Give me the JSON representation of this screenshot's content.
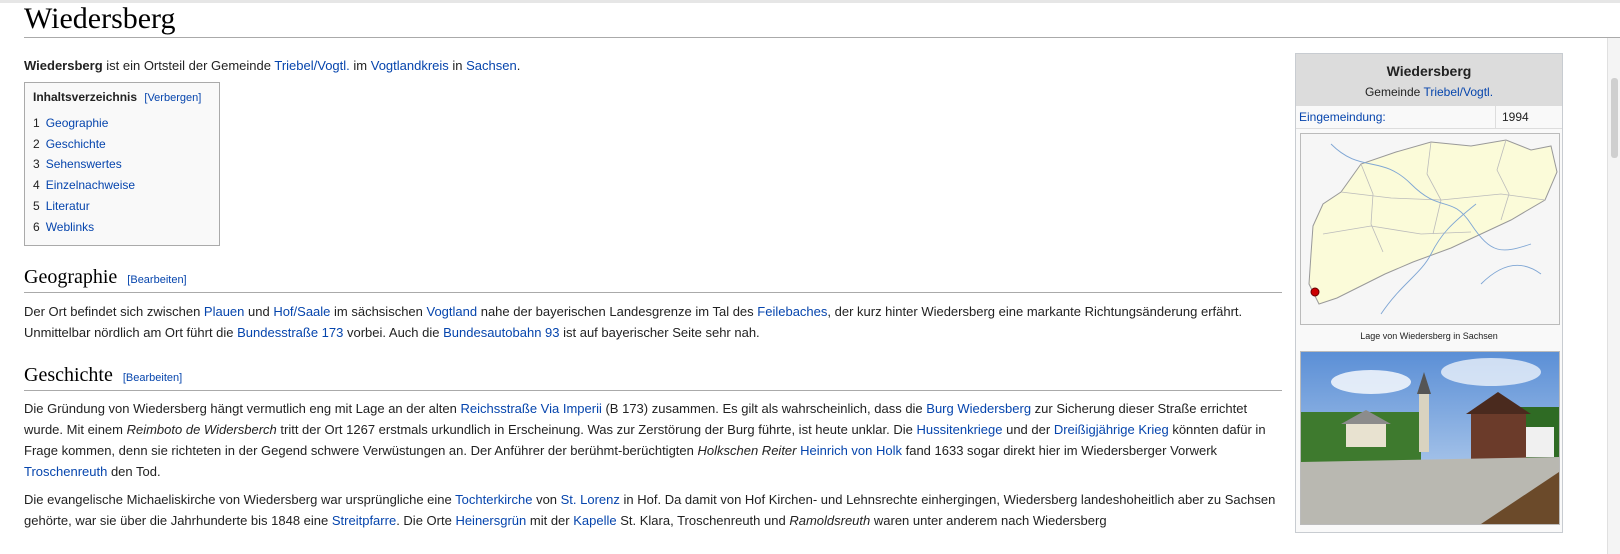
{
  "page": {
    "title": "Wiedersberg"
  },
  "intro": {
    "subject": "Wiedersberg",
    "t1": " ist ein Ortsteil der Gemeinde ",
    "l1": "Triebel/Vogtl.",
    "t2": " im ",
    "l2": "Vogtlandkreis",
    "t3": " in ",
    "l3": "Sachsen",
    "t4": "."
  },
  "toc": {
    "heading": "Inhaltsverzeichnis",
    "toggle": "[Verbergen]",
    "items": [
      {
        "num": "1",
        "label": "Geographie"
      },
      {
        "num": "2",
        "label": "Geschichte"
      },
      {
        "num": "3",
        "label": "Sehenswertes"
      },
      {
        "num": "4",
        "label": "Einzelnachweise"
      },
      {
        "num": "5",
        "label": "Literatur"
      },
      {
        "num": "6",
        "label": "Weblinks"
      }
    ]
  },
  "geographie": {
    "heading": "Geographie",
    "edit": "[Bearbeiten]",
    "p": [
      "Der Ort befindet sich zwischen ",
      "Plauen",
      " und ",
      "Hof/Saale",
      " im sächsischen ",
      "Vogtland",
      " nahe der bayerischen Landesgrenze im Tal des ",
      "Feilebaches",
      ", der kurz hinter Wiedersberg eine markante Richtungsänderung erfährt. Unmittelbar nördlich am Ort führt die ",
      "Bundesstraße 173",
      " vorbei. Auch die ",
      "Bundesautobahn 93",
      " ist auf bayerischer Seite sehr nah."
    ]
  },
  "geschichte": {
    "heading": "Geschichte",
    "edit": "[Bearbeiten]",
    "p1": [
      "Die Gründung von Wiedersberg hängt vermutlich eng mit Lage an der alten ",
      "Reichsstraße Via Imperii",
      " (B 173) zusammen. Es gilt als wahrscheinlich, dass die ",
      "Burg Wiedersberg",
      " zur Sicherung dieser Straße errichtet wurde. Mit einem ",
      "Reimboto de Widersberch",
      " tritt der Ort 1267 erstmals urkundlich in Erscheinung. Was zur Zerstörung der Burg führte, ist heute unklar. Die ",
      "Hussitenkriege",
      " und der ",
      "Dreißigjährige Krieg",
      " könnten dafür in Frage kommen, denn sie richteten in der Gegend schwere Verwüstungen an. Der Anführer der berühmt-berüchtigten ",
      "Holkschen Reiter",
      " ",
      "Heinrich von Holk",
      " fand 1633 sogar direkt hier im Wiedersberger Vorwerk ",
      "Troschenreuth",
      " den Tod."
    ],
    "p2": [
      "Die evangelische Michaeliskirche von Wiedersberg war ursprüngliche eine ",
      "Tochterkirche",
      " von ",
      "St. Lorenz",
      " in Hof. Da damit von Hof Kirchen- und Lehnsrechte einhergingen, Wiedersberg landeshoheitlich aber zu Sachsen gehörte, war sie über die Jahrhunderte bis 1848 eine ",
      "Streitpfarre",
      ". Die Orte ",
      "Heinersgrün",
      " mit der ",
      "Kapelle",
      " St. Klara, Troschenreuth und ",
      "Ramoldsreuth",
      " waren unter anderem nach Wiedersberg"
    ]
  },
  "infobox": {
    "title": "Wiedersberg",
    "sub_prefix": "Gemeinde ",
    "sub_link": "Triebel/Vogtl.",
    "row_key": "Eingemeindung:",
    "row_value": "1994",
    "map_caption": "Lage von Wiedersberg in Sachsen"
  },
  "colors": {
    "link": "#0645ad",
    "infobox_head": "#dcdcdc",
    "map_fill": "#fbfbd9",
    "marker": "#cc0000"
  }
}
